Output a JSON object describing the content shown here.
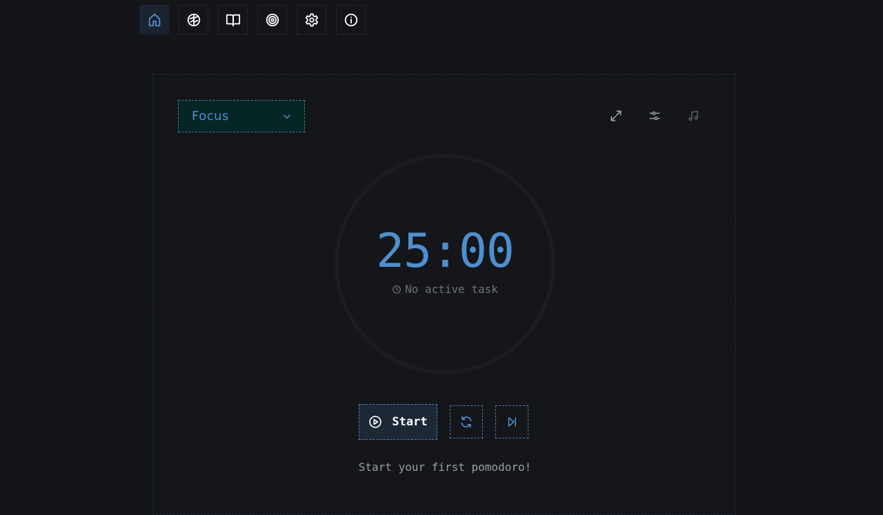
{
  "nav": {
    "items": [
      {
        "icon": "home-icon",
        "active": true
      },
      {
        "icon": "brain-icon",
        "active": false
      },
      {
        "icon": "book-icon",
        "active": false
      },
      {
        "icon": "target-icon",
        "active": false
      },
      {
        "icon": "gear-icon",
        "active": false
      },
      {
        "icon": "info-icon",
        "active": false
      }
    ]
  },
  "mode": {
    "selected": "Focus"
  },
  "toolbar": {
    "icons": [
      "expand-icon",
      "sliders-icon",
      "music-icon"
    ]
  },
  "timer": {
    "display": "25:00",
    "task_status": "No active task"
  },
  "controls": {
    "start_label": "Start"
  },
  "message": "Start your first pomodoro!",
  "colors": {
    "accent": "#4f8fcf",
    "background": "#131519",
    "panel": "#14161a",
    "select_bg": "#062626"
  }
}
